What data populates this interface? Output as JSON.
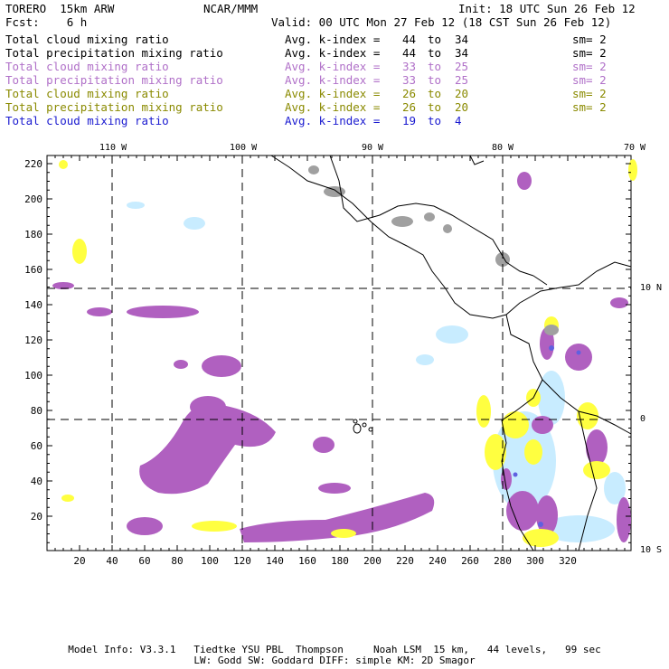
{
  "header": {
    "model": "TORERO  15km ARW",
    "center": "NCAR/MMM",
    "init": "Init: 18 UTC Sun 26 Feb 12",
    "fcst": "Fcst:    6 h",
    "valid": "Valid: 00 UTC Mon 27 Feb 12 (18 CST Sun 26 Feb 12)"
  },
  "legend": [
    {
      "field": "Total cloud mixing ratio",
      "kidx": "Avg. k-index = ",
      "range_lo": "44",
      "to": "to",
      "range_hi": "34",
      "sm": "sm= 2",
      "color": "#000000"
    },
    {
      "field": "Total precipitation mixing ratio",
      "kidx": "Avg. k-index = ",
      "range_lo": "44",
      "to": "to",
      "range_hi": "34",
      "sm": "sm= 2",
      "color": "#000000"
    },
    {
      "field": "Total cloud mixing ratio",
      "kidx": "Avg. k-index = ",
      "range_lo": "33",
      "to": "to",
      "range_hi": "25",
      "sm": "sm= 2",
      "color": "#b070c8"
    },
    {
      "field": "Total precipitation mixing ratio",
      "kidx": "Avg. k-index = ",
      "range_lo": "33",
      "to": "to",
      "range_hi": "25",
      "sm": "sm= 2",
      "color": "#b070c8"
    },
    {
      "field": "Total cloud mixing ratio",
      "kidx": "Avg. k-index = ",
      "range_lo": "26",
      "to": "to",
      "range_hi": "20",
      "sm": "sm= 2",
      "color": "#8a8a00"
    },
    {
      "field": "Total precipitation mixing ratio",
      "kidx": "Avg. k-index = ",
      "range_lo": "26",
      "to": "to",
      "range_hi": "20",
      "sm": "sm= 2",
      "color": "#8a8a00"
    },
    {
      "field": "Total cloud mixing ratio",
      "kidx": "Avg. k-index = ",
      "range_lo": "19",
      "to": "to",
      "range_hi": "4",
      "sm": "",
      "color": "#1a1ad0"
    }
  ],
  "axes": {
    "lon_labels": [
      "110 W",
      "100 W",
      "90 W",
      "80 W",
      "70 W"
    ],
    "lat_labels": [
      "10 N",
      "0",
      "10 S"
    ],
    "x_ticks": [
      "20",
      "40",
      "60",
      "80",
      "100",
      "120",
      "140",
      "160",
      "180",
      "200",
      "220",
      "240",
      "260",
      "280",
      "300",
      "320"
    ],
    "y_ticks": [
      "220",
      "200",
      "180",
      "160",
      "140",
      "120",
      "100",
      "80",
      "60",
      "40",
      "20"
    ]
  },
  "footer": {
    "line1": "Model Info: V3.3.1   Tiedtke YSU PBL  Thompson     Noah LSM  15 km,   44 levels,   99 sec",
    "line2": "LW: Godd SW: Goddard DIFF: simple KM: 2D Smagor"
  },
  "colors": {
    "gray": "#a0a0a0",
    "purple": "#b060c0",
    "yellow": "#ffff40",
    "lightblue": "#c8ecff",
    "blue": "#6060e0"
  }
}
